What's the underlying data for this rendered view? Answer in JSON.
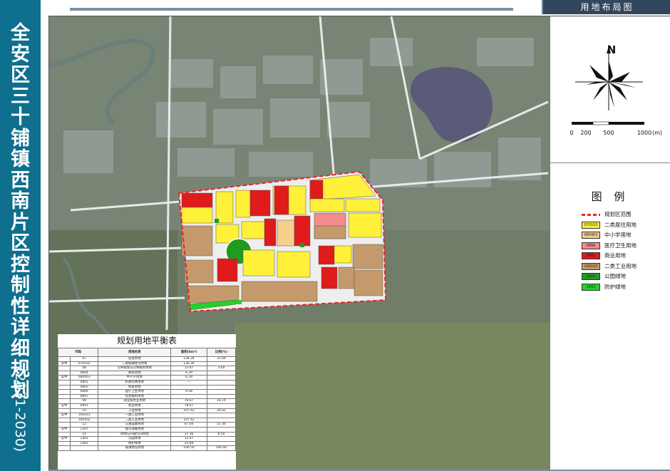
{
  "title_vertical": "全安区三十铺镇西南片区控制性详细规划",
  "title_years": "(2021-2030)",
  "header_tab": "用地布局图",
  "compass": {
    "north_label": "N"
  },
  "scale_bar": {
    "labels": [
      "0",
      "200",
      "500",
      "1000"
    ],
    "unit": "(m)"
  },
  "legend": {
    "title": "图  例",
    "items": [
      {
        "code": "",
        "label": "规划区范围",
        "color": "#e8272a",
        "kind": "boundary"
      },
      {
        "code": "070102",
        "label": "二类居住用地",
        "color": "#fff03a",
        "kind": "fill"
      },
      {
        "code": "080403",
        "label": "中小学用地",
        "color": "#f6cf8c",
        "kind": "fill"
      },
      {
        "code": "0806",
        "label": "医疗卫生用地",
        "color": "#f28b8b",
        "kind": "fill"
      },
      {
        "code": "0901",
        "label": "商业用地",
        "color": "#e01b1b",
        "kind": "fill"
      },
      {
        "code": "100102",
        "label": "二类工业用地",
        "color": "#c49a6c",
        "kind": "fill"
      },
      {
        "code": "1401",
        "label": "公园绿地",
        "color": "#1f9b1f",
        "kind": "fill"
      },
      {
        "code": "1402",
        "label": "防护绿地",
        "color": "#22d12a",
        "kind": "fill"
      }
    ]
  },
  "stats": {
    "title": "规划用地平衡表",
    "headers": [
      "代码",
      "用地名称",
      "面积(hm²)",
      "比例(%)"
    ],
    "rows": [
      [
        "",
        "07",
        "居住用地",
        "136.34",
        "31.69"
      ],
      [
        "其中",
        "070102",
        "二类城镇住宅用地",
        "136.34",
        ""
      ],
      [
        "",
        "08",
        "公共管理与公共服务用地",
        "15.87",
        "3.64"
      ],
      [
        "",
        "0804",
        "教育用地",
        "6.29",
        ""
      ],
      [
        "其中",
        "080403",
        "中小学用地",
        "6.29",
        ""
      ],
      [
        "",
        "0801",
        "机关团体用地",
        "—",
        ""
      ],
      [
        "",
        "0805",
        "体育用地",
        "",
        ""
      ],
      [
        "",
        "0806",
        "医疗卫生用地",
        "9.58",
        ""
      ],
      [
        "",
        "0807",
        "社会福利用地",
        "",
        ""
      ],
      [
        "",
        "09",
        "商业服务业用地",
        "78.67",
        "18.19"
      ],
      [
        "其中",
        "0901",
        "商业用地",
        "78.67",
        ""
      ],
      [
        "",
        "10",
        "工业用地",
        "107.42",
        "24.62"
      ],
      [
        "其中",
        "100101",
        "一类工业用地",
        "",
        ""
      ],
      [
        "",
        "100102",
        "二类工业用地",
        "107.42",
        ""
      ],
      [
        "",
        "12",
        "交通运输用地",
        "67.04",
        "15.36"
      ],
      [
        "其中",
        "1207",
        "城市道路用地",
        "",
        ""
      ],
      [
        "",
        "14",
        "绿地与开敞空间用地",
        "37.36",
        "8.50"
      ],
      [
        "其中",
        "1401",
        "公园绿地",
        "12.47",
        ""
      ],
      [
        "",
        "1402",
        "防护绿地",
        "24.89",
        ""
      ],
      [
        "",
        "",
        "城镇建设用地",
        "436.50",
        "100.00"
      ]
    ]
  }
}
